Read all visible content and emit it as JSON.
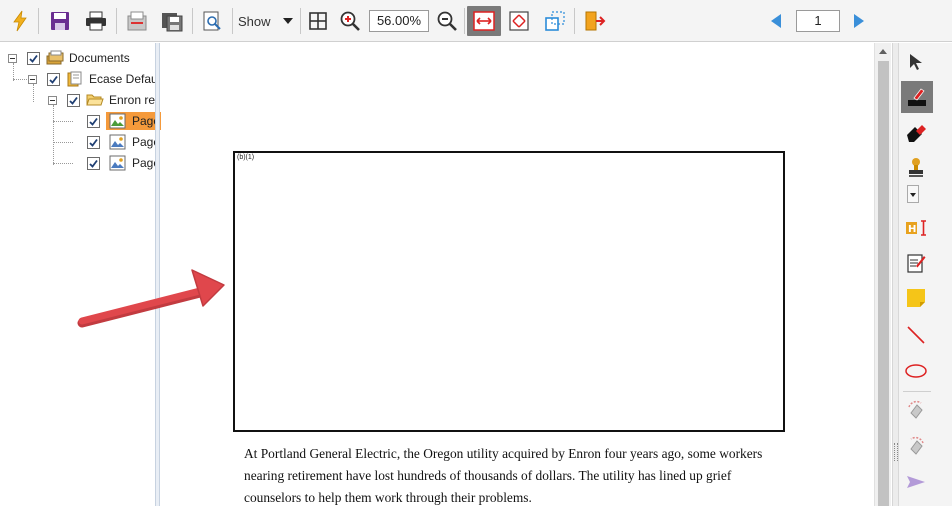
{
  "toolbar": {
    "buttons": [
      {
        "name": "process-icon",
        "color": "#f2b01e"
      },
      {
        "name": "save-icon",
        "color": "#6a2d91"
      },
      {
        "name": "print-icon",
        "color": "#333333"
      },
      {
        "name": "export-icon"
      },
      {
        "name": "save-as-icon"
      },
      {
        "name": "preview-icon"
      },
      {
        "name": "fit-grid-icon"
      },
      {
        "name": "zoom-in-icon"
      },
      {
        "name": "zoom-out-icon"
      },
      {
        "name": "fit-width-icon",
        "pressed": true
      },
      {
        "name": "fit-page-icon"
      },
      {
        "name": "select-area-icon"
      },
      {
        "name": "exit-icon"
      }
    ],
    "show_label": "Show",
    "zoom_value": "56.00%",
    "page_number": "1"
  },
  "tree": {
    "root_label": "Documents",
    "collection_label": "Ecase Defau",
    "folder_label": "Enron re",
    "pages": [
      {
        "label": "Page",
        "selected": true
      },
      {
        "label": "Page",
        "selected": false
      },
      {
        "label": "Page",
        "selected": false
      }
    ]
  },
  "document": {
    "redaction_code": "(b)(1)",
    "paragraph_lines": [
      "At Portland General Electric, the Oregon utility acquired by Enron four years ago, some workers",
      "nearing retirement have lost hundreds of thousands of dollars. The utility has lined up grief",
      "counselors to help them work through their problems."
    ]
  },
  "right_tools": [
    {
      "name": "select-pointer-icon"
    },
    {
      "name": "redact-marker-icon",
      "pressed": true
    },
    {
      "name": "eraser-redact-icon"
    },
    {
      "name": "stamp-icon"
    },
    {
      "name": "text-redact-icon"
    },
    {
      "name": "note-edit-icon"
    },
    {
      "name": "sticky-note-icon"
    },
    {
      "name": "line-tool-icon"
    },
    {
      "name": "ellipse-tool-icon"
    },
    {
      "name": "rotate-left-icon"
    },
    {
      "name": "rotate-right-icon"
    },
    {
      "name": "send-icon"
    }
  ],
  "colors": {
    "accent_orange": "#f59a3b",
    "annotation_arrow": "#e0474c",
    "nav_arrow": "#3a8fd9"
  }
}
